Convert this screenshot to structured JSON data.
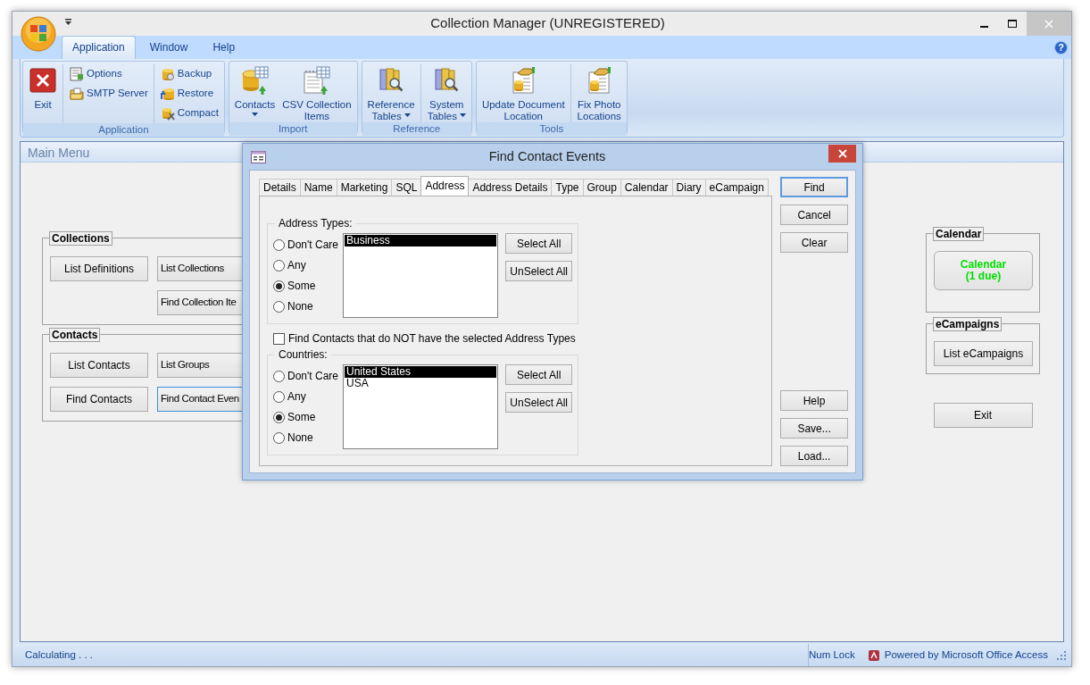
{
  "window": {
    "title": "Collection Manager (UNREGISTERED)"
  },
  "ribbon": {
    "tabs": [
      {
        "label": "Application",
        "selected": true
      },
      {
        "label": "Window",
        "selected": false
      },
      {
        "label": "Help",
        "selected": false
      }
    ],
    "help_glyph": "?",
    "groups": [
      {
        "label": "Application",
        "columns": [
          [
            {
              "label": "Exit",
              "kind": "large",
              "dropdown": false
            }
          ],
          [
            {
              "label": "Options",
              "kind": "small",
              "dropdown": false
            },
            {
              "label": "SMTP Server",
              "kind": "small",
              "dropdown": false
            }
          ],
          [
            {
              "label": "Backup",
              "kind": "small",
              "dropdown": false
            },
            {
              "label": "Restore",
              "kind": "small",
              "dropdown": false
            },
            {
              "label": "Compact",
              "kind": "small",
              "dropdown": false
            }
          ]
        ]
      },
      {
        "label": "Import",
        "columns": [
          [
            {
              "label": "Contacts",
              "kind": "large",
              "dropdown": true
            }
          ],
          [
            {
              "label": "CSV Collection\nItems",
              "kind": "large",
              "dropdown": false
            }
          ]
        ]
      },
      {
        "label": "Reference",
        "columns": [
          [
            {
              "label": "Reference\nTables",
              "kind": "large",
              "dropdown": true
            }
          ],
          [
            {
              "label": "System\nTables",
              "kind": "large",
              "dropdown": true
            }
          ]
        ]
      },
      {
        "label": "Tools",
        "columns": [
          [
            {
              "label": "Update Document\nLocation",
              "kind": "large",
              "dropdown": false
            }
          ],
          [
            {
              "label": "Fix Photo\nLocations",
              "kind": "large",
              "dropdown": false
            }
          ]
        ]
      }
    ]
  },
  "main_form": {
    "title": "Main Menu",
    "left_groups": [
      {
        "label": "Collections",
        "rows": [
          [
            {
              "label": "List Definitions",
              "focused": false
            },
            {
              "label": "List Collections",
              "focused": false
            }
          ],
          [
            null,
            {
              "label": "Find Collection Ite",
              "focused": false
            }
          ]
        ]
      },
      {
        "label": "Contacts",
        "rows": [
          [
            {
              "label": "List Contacts",
              "focused": false
            },
            {
              "label": "List Groups",
              "focused": false
            }
          ],
          [
            {
              "label": "Find Contacts",
              "focused": false
            },
            {
              "label": "Find Contact Even",
              "focused": true
            }
          ]
        ]
      }
    ],
    "right_groups": [
      {
        "label": "Calendar",
        "button": {
          "label": "Calendar\n(1 due)",
          "alert": true
        }
      },
      {
        "label": "eCampaigns",
        "button": {
          "label": "List eCampaigns",
          "alert": false
        }
      }
    ],
    "exit_button": {
      "label": "Exit"
    }
  },
  "dialog": {
    "title": "Find Contact Events",
    "tabs": [
      {
        "label": "Details",
        "selected": false
      },
      {
        "label": "Name",
        "selected": false
      },
      {
        "label": "Marketing",
        "selected": false
      },
      {
        "label": "SQL",
        "selected": false
      },
      {
        "label": "Address",
        "selected": true
      },
      {
        "label": "Address Details",
        "selected": false
      },
      {
        "label": "Type",
        "selected": false
      },
      {
        "label": "Group",
        "selected": false
      },
      {
        "label": "Calendar",
        "selected": false
      },
      {
        "label": "Diary",
        "selected": false
      },
      {
        "label": "eCampaign",
        "selected": false
      }
    ],
    "sections": [
      {
        "kind": "filter",
        "legend": "Address Types:",
        "options": [
          {
            "label": "Don't Care",
            "selected": false
          },
          {
            "label": "Any",
            "selected": false
          },
          {
            "label": "Some",
            "selected": true
          },
          {
            "label": "None",
            "selected": false
          }
        ],
        "list": [
          {
            "label": "Business",
            "selected": true
          }
        ],
        "buttons": [
          "Select All",
          "UnSelect All"
        ]
      },
      {
        "kind": "checkbox",
        "label": "Find Contacts that do NOT have the selected Address Types",
        "checked": false
      },
      {
        "kind": "filter",
        "legend": "Countries:",
        "options": [
          {
            "label": "Don't Care",
            "selected": false
          },
          {
            "label": "Any",
            "selected": false
          },
          {
            "label": "Some",
            "selected": true
          },
          {
            "label": "None",
            "selected": false
          }
        ],
        "list": [
          {
            "label": "United States",
            "selected": true
          },
          {
            "label": "USA",
            "selected": false
          }
        ],
        "buttons": [
          "Select All",
          "UnSelect All"
        ]
      }
    ],
    "buttons": [
      {
        "label": "Find",
        "kind": "top",
        "default": true
      },
      {
        "label": "Cancel",
        "kind": "top",
        "default": false
      },
      {
        "label": "Clear",
        "kind": "top",
        "default": false
      },
      {
        "label": "Help",
        "kind": "bottom",
        "default": false
      },
      {
        "label": "Save...",
        "kind": "bottom",
        "default": false
      },
      {
        "label": "Load...",
        "kind": "bottom",
        "default": false
      }
    ]
  },
  "status_bar": {
    "message": "Calculating . . .",
    "num_lock": "Num Lock",
    "powered_by": "Powered by Microsoft Office Access"
  }
}
